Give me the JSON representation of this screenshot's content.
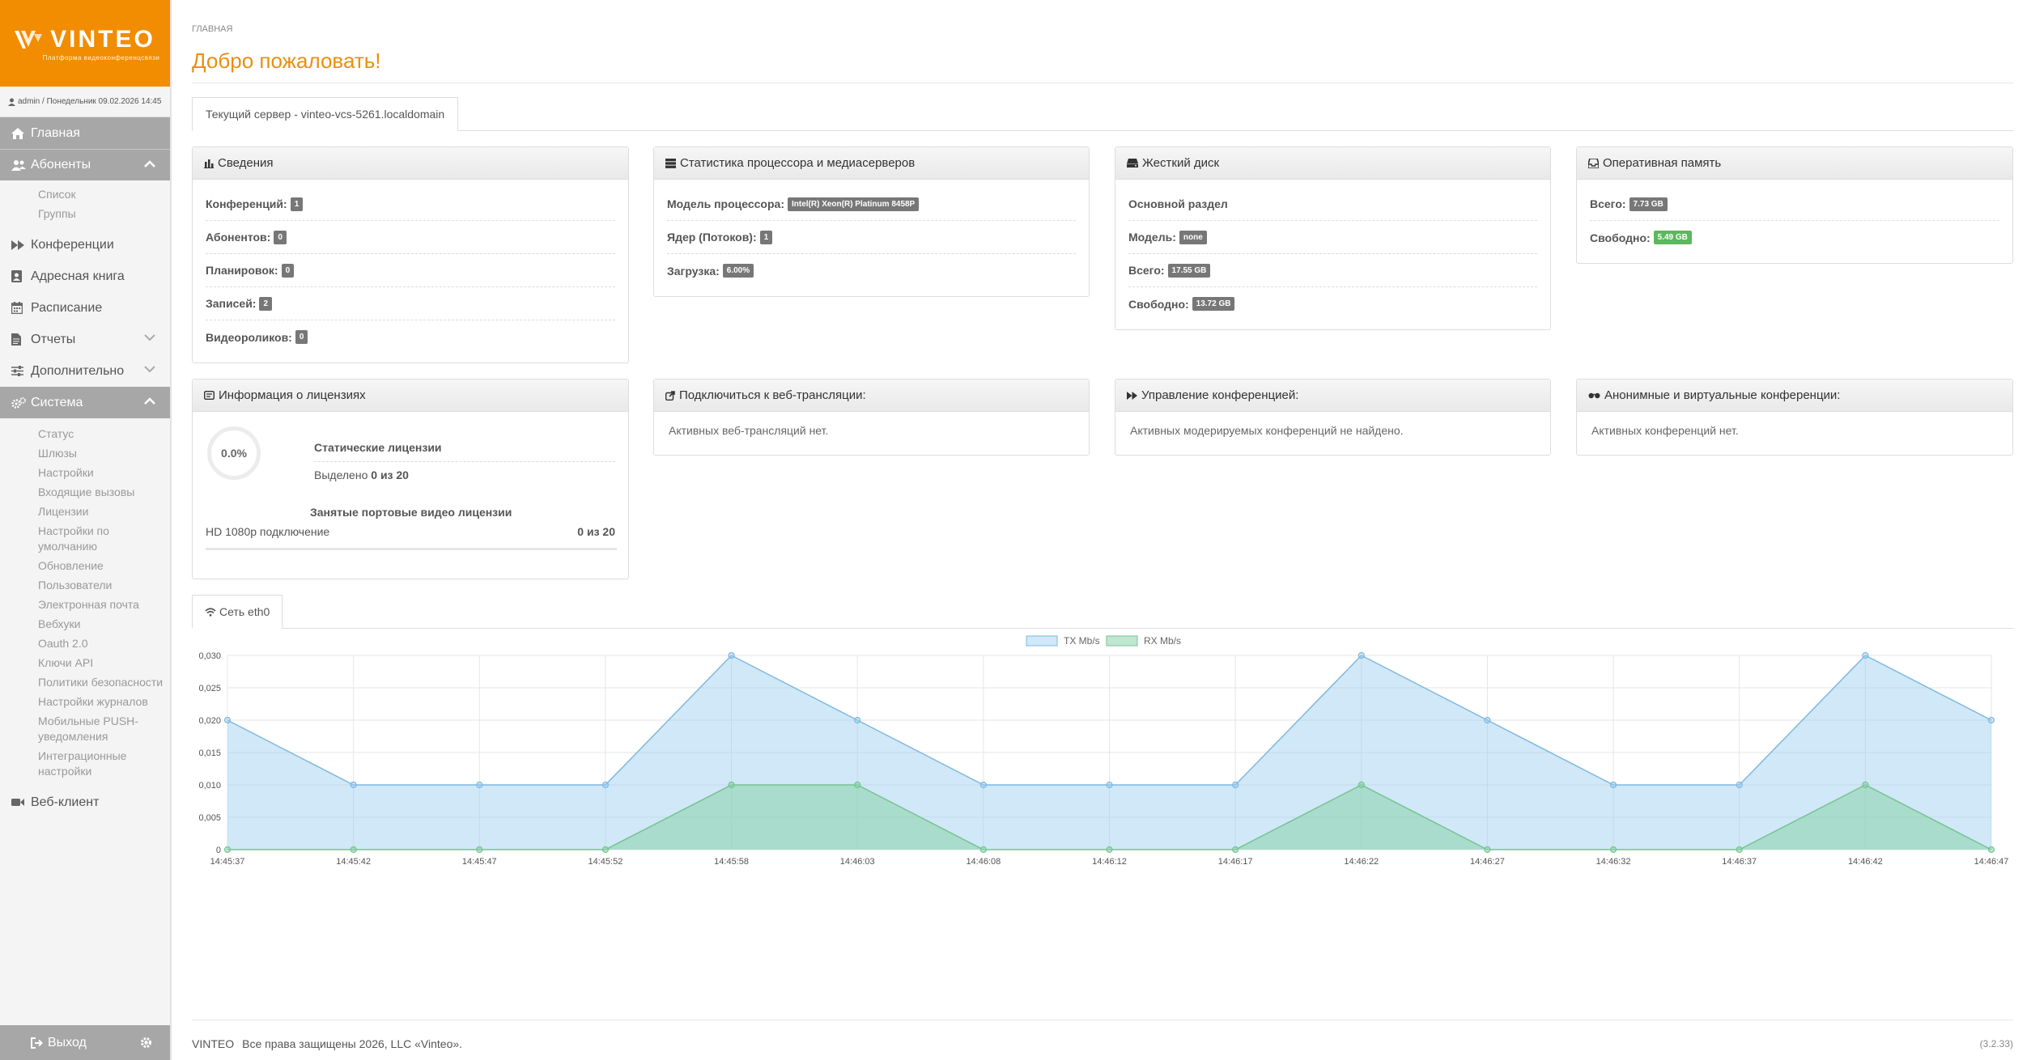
{
  "brand": {
    "name": "VINTEO",
    "tagline": "Платформа видеоконференцсвязи"
  },
  "user": {
    "line": "admin / Понедельник 09.02.2026 14:45"
  },
  "nav": {
    "home": "Главная",
    "subscribers": "Абоненты",
    "subscribers_sub": [
      "Список",
      "Группы"
    ],
    "conferences": "Конференции",
    "addressbook": "Адресная книга",
    "schedule": "Расписание",
    "reports": "Отчеты",
    "additional": "Дополнительно",
    "system": "Система",
    "system_sub": [
      "Статус",
      "Шлюзы",
      "Настройки",
      "Входящие вызовы",
      "Лицензии",
      "Настройки по умолчанию",
      "Обновление",
      "Пользователи",
      "Электронная почта",
      "Вебхуки",
      "Oauth 2.0",
      "Ключи API",
      "Политики безопасности",
      "Настройки журналов",
      "Мобильные PUSH-уведомления",
      "Интеграционные настройки"
    ],
    "webclient": "Веб-клиент",
    "logout": "Выход"
  },
  "page": {
    "breadcrumb": "Главная",
    "title": "Добро пожаловать!",
    "server_tab": "Текущий сервер - vinteo-vcs-5261.localdomain"
  },
  "info": {
    "title": "Сведения",
    "rows": [
      {
        "label": "Конференций:",
        "value": "1"
      },
      {
        "label": "Абонентов:",
        "value": "0"
      },
      {
        "label": "Планировок:",
        "value": "0"
      },
      {
        "label": "Записей:",
        "value": "2"
      },
      {
        "label": "Видеороликов:",
        "value": "0"
      }
    ]
  },
  "cpu": {
    "title": "Статистика процессора и медиасерверов",
    "rows": [
      {
        "label": "Модель процессора:",
        "value": "Intel(R) Xeon(R) Platinum 8458P"
      },
      {
        "label": "Ядер (Потоков):",
        "value": "1"
      },
      {
        "label": "Загрузка:",
        "value": "6.00%"
      }
    ]
  },
  "disk": {
    "title": "Жесткий диск",
    "section": "Основной раздел",
    "rows": [
      {
        "label": "Модель:",
        "value": "none"
      },
      {
        "label": "Всего:",
        "value": "17.55 GB"
      },
      {
        "label": "Свободно:",
        "value": "13.72 GB"
      }
    ]
  },
  "ram": {
    "title": "Оперативная память",
    "rows": [
      {
        "label": "Всего:",
        "value": "7.73 GB"
      },
      {
        "label": "Свободно:",
        "value": "5.49 GB"
      }
    ]
  },
  "licenses": {
    "title": "Информация о лицензиях",
    "percent": "0.0%",
    "static_title": "Статические лицензии",
    "allocated_label": "Выделено",
    "allocated_value": "0 из 20",
    "port_title": "Занятые портовые видео лицензии",
    "hd_label": "HD 1080p подключение",
    "hd_value": "0 из 20"
  },
  "web": {
    "title": "Подключиться к веб-трансляции:",
    "text": "Активных веб-трансляций нет."
  },
  "manage": {
    "title": "Управление конференцией:",
    "text": "Активных модерируемых конференций не найдено."
  },
  "anon": {
    "title": "Анонимные и виртуальные конференции:",
    "text": "Активных конференций нет."
  },
  "network": {
    "tab": "Сеть eth0"
  },
  "chart_data": {
    "type": "area",
    "x": [
      "14:45:37",
      "14:45:42",
      "14:45:47",
      "14:45:52",
      "14:45:58",
      "14:46:03",
      "14:46:08",
      "14:46:12",
      "14:46:17",
      "14:46:22",
      "14:46:27",
      "14:46:32",
      "14:46:37",
      "14:46:42",
      "14:46:47"
    ],
    "series": [
      {
        "name": "TX Mb/s",
        "values": [
          0.02,
          0.01,
          0.01,
          0.01,
          0.03,
          0.02,
          0.01,
          0.01,
          0.01,
          0.03,
          0.02,
          0.01,
          0.01,
          0.03,
          0.02
        ],
        "color": "#7fb8de"
      },
      {
        "name": "RX Mb/s",
        "values": [
          0,
          0,
          0,
          0,
          0.01,
          0.01,
          0,
          0,
          0,
          0.01,
          0,
          0,
          0,
          0.01,
          0
        ],
        "color": "#74c48f"
      }
    ],
    "yticks": [
      "0",
      "0,005",
      "0,010",
      "0,015",
      "0,020",
      "0,025",
      "0,030"
    ],
    "ylim": [
      0,
      0.03
    ],
    "legend": "top-center",
    "grid": true
  },
  "footer": {
    "brand": "VINTEO",
    "copyright": "Все права защищены 2026, LLC «Vinteo».",
    "version": "(3.2.33)"
  }
}
